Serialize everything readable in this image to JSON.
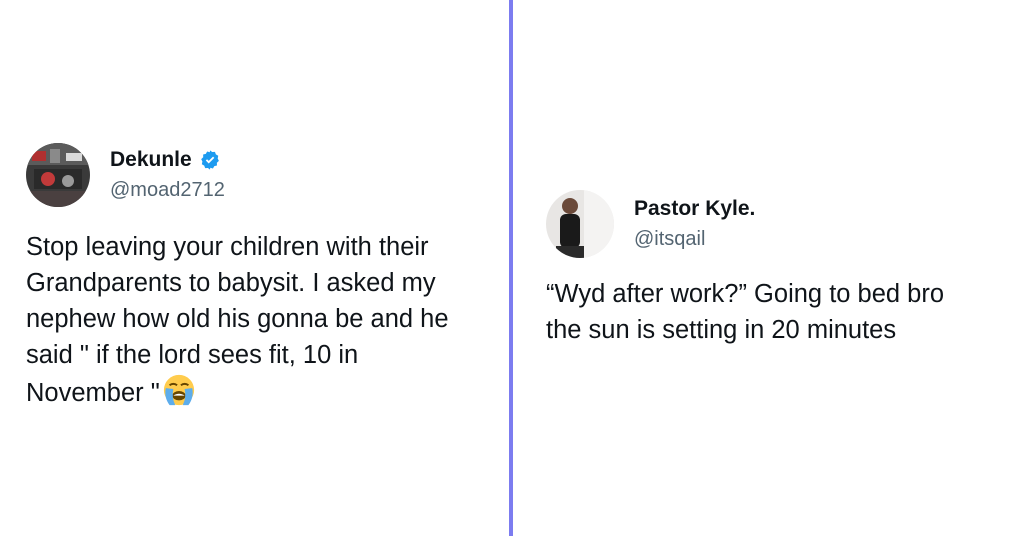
{
  "colors": {
    "divider": "#7c7cf0",
    "verified_badge": "#1d9bf0",
    "handle_text": "#536471"
  },
  "left_tweet": {
    "display_name": "Dekunle",
    "handle": "@moad2712",
    "verified": true,
    "verified_icon": "verified-badge-icon",
    "text": "Stop leaving your children with their\nGrandparents to babysit. I asked my\nnephew how old his gonna be and he\nsaid \" if the lord sees fit, 10 in\nNovember \"",
    "emoji": "loudly-crying-face-icon"
  },
  "right_tweet": {
    "display_name": "Pastor Kyle.",
    "handle": "@itsqail",
    "text": "“Wyd after work?” Going to bed bro\nthe sun is setting in 20 minutes"
  }
}
